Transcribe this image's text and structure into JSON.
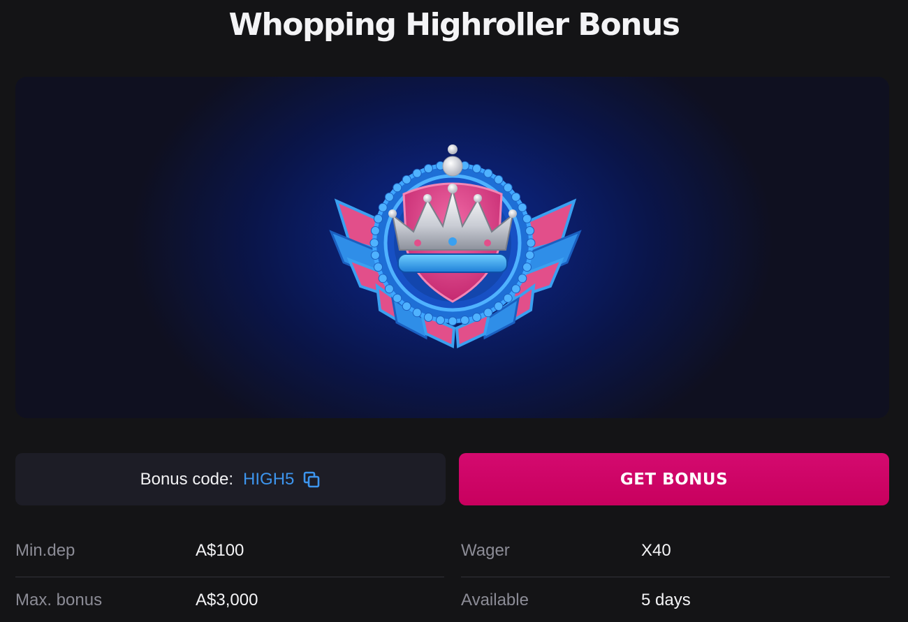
{
  "title": "Whopping Highroller Bonus",
  "hero": {
    "image_icon": "crown-badge-icon"
  },
  "bonus_code": {
    "label": "Bonus code:",
    "value": "HIGH5",
    "copy_icon": "copy-icon"
  },
  "cta": {
    "label": "GET BONUS"
  },
  "details": {
    "left": [
      {
        "label": "Min.dep",
        "value": "A$100"
      },
      {
        "label": "Max. bonus",
        "value": "A$3,000"
      }
    ],
    "right": [
      {
        "label": "Wager",
        "value": "X40"
      },
      {
        "label": "Available",
        "value": "5 days"
      }
    ]
  },
  "colors": {
    "background": "#141416",
    "accent": "#c8005e",
    "code": "#3d95ee",
    "panel": "#1d1d26"
  }
}
